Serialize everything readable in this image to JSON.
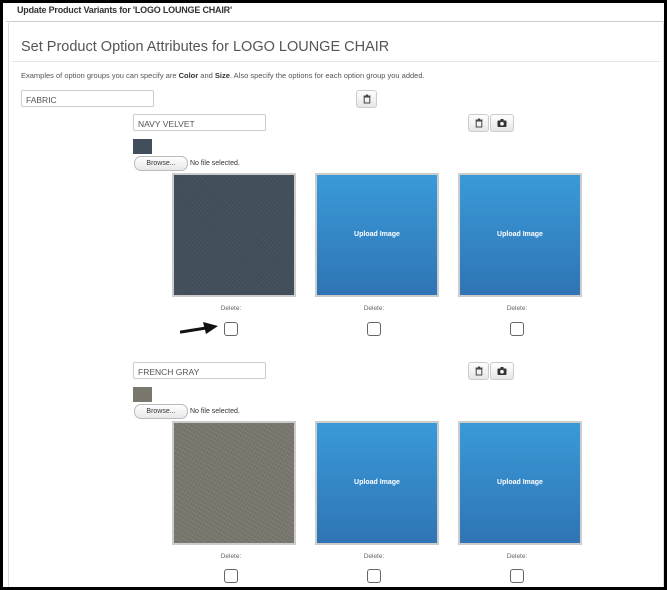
{
  "window": {
    "title": "Update Product Variants for 'LOGO LOUNGE CHAIR'"
  },
  "page": {
    "heading": "Set Product Option Attributes for LOGO LOUNGE CHAIR",
    "help_prefix": "Examples of option groups you can specify are ",
    "help_color": "Color",
    "help_and": " and ",
    "help_size": "Size",
    "help_suffix": ". Also specify the options for each option group you added."
  },
  "option_group": {
    "value": "FABRIC",
    "delete_icon": "trash-icon"
  },
  "options": [
    {
      "value": "NAVY VELVET",
      "swatch_color": "#434e5c",
      "browse_label": "Browse...",
      "file_status": "No file selected.",
      "images": [
        {
          "label": "",
          "delete_label": "Delete:",
          "checked": false
        },
        {
          "label": "Upload Image",
          "delete_label": "Delete:",
          "checked": false
        },
        {
          "label": "Upload Image",
          "delete_label": "Delete:",
          "checked": false
        }
      ]
    },
    {
      "value": "FRENCH GRAY",
      "swatch_color": "#7a776e",
      "browse_label": "Browse...",
      "file_status": "No file selected.",
      "images": [
        {
          "label": "",
          "delete_label": "Delete:",
          "checked": false
        },
        {
          "label": "Upload Image",
          "delete_label": "Delete:",
          "checked": false
        },
        {
          "label": "Upload Image",
          "delete_label": "Delete:",
          "checked": false
        }
      ]
    }
  ],
  "icons": {
    "delete": "trash-icon",
    "camera": "camera-icon",
    "arrow": "arrow-pointer-icon"
  }
}
